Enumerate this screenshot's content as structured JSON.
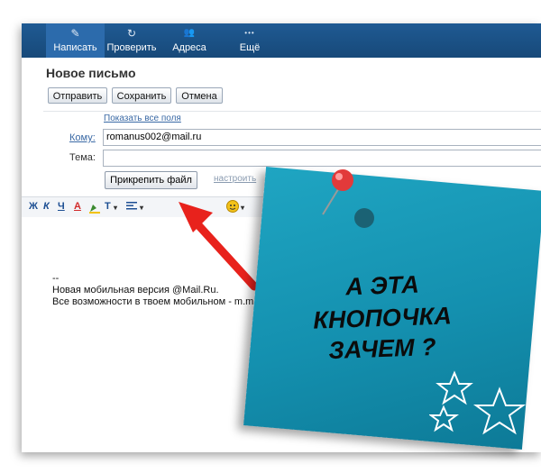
{
  "toolbar": {
    "items": [
      {
        "label": "Написать",
        "icon": "pencil-icon",
        "glyph": "✎",
        "active": true
      },
      {
        "label": "Проверить",
        "icon": "refresh-icon",
        "glyph": "↻",
        "active": false
      },
      {
        "label": "Адреса",
        "icon": "contacts-icon",
        "glyph": "👥",
        "active": false
      },
      {
        "label": "Ещё",
        "icon": "more-dots-icon",
        "glyph": "•••",
        "active": false
      }
    ]
  },
  "compose": {
    "title": "Новое письмо",
    "buttons": {
      "send": "Отправить",
      "save": "Сохранить",
      "cancel": "Отмена"
    },
    "show_all_fields": "Показать все поля",
    "to_label": "Кому:",
    "to_value": "romanus002@mail.ru",
    "subject_label": "Тема:",
    "subject_value": "",
    "attach_button": "Прикрепить файл",
    "settings_link": "настроить"
  },
  "format_toolbar": {
    "bold": "Ж",
    "italic": "К",
    "underline": "Ч",
    "text_color": "A",
    "font_size": "T"
  },
  "signature": {
    "dashes": "--",
    "line1": "Новая мобильная версия @Mail.Ru.",
    "line2": "Все возможности в твоем мобильном - m.m"
  },
  "note": {
    "line1": "А ЭТА",
    "line2": "КНОПОЧКА",
    "line3": "ЗАЧЕМ ?",
    "color": "#1a9bb8"
  },
  "colors": {
    "toolbar_bg": "#1f5a93",
    "arrow": "#e8221c",
    "pin": "#e23a3a",
    "link": "#3a69a5"
  }
}
